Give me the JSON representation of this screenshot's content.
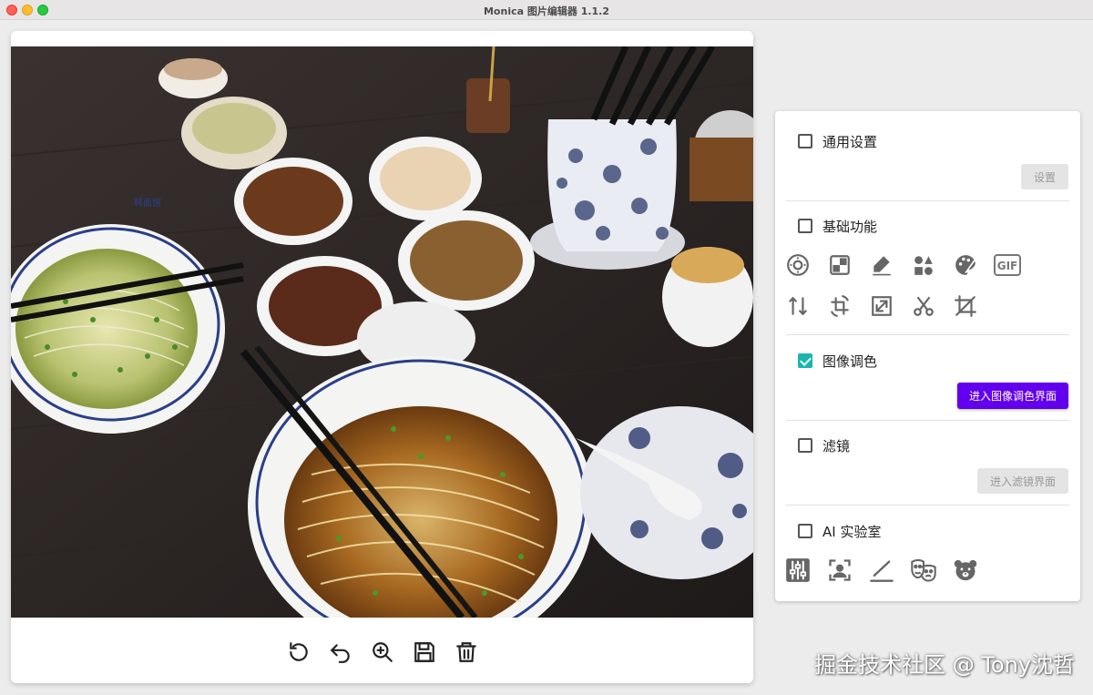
{
  "window": {
    "title": "Monica 图片编辑器 1.1.2"
  },
  "canvas": {
    "image_alt": "Two bowls of noodle soup with chopsticks, side dishes and a blue-and-white porcelain chopstick holder on a dark wooden table",
    "bowl_text": "韩面馆"
  },
  "toolbar": {
    "tools": [
      "rotate-icon",
      "undo-icon",
      "zoom-in-icon",
      "save-icon",
      "delete-icon"
    ]
  },
  "settings": {
    "general": {
      "label": "通用设置",
      "checked": false,
      "button": "设置"
    },
    "basic": {
      "label": "基础功能",
      "checked": false,
      "icons_row1": [
        "circle-blur-icon",
        "mosaic-icon",
        "draw-icon",
        "shapes-icon",
        "palette-icon",
        "gif-icon"
      ],
      "icons_row2": [
        "flip-icon",
        "rotate-crop-icon",
        "resize-icon",
        "cut-icon",
        "crop-icon"
      ],
      "gif_text": "GIF"
    },
    "color": {
      "label": "图像调色",
      "checked": true,
      "button": "进入图像调色界面"
    },
    "filter": {
      "label": "滤镜",
      "checked": false,
      "button": "进入滤镜界面"
    },
    "ai": {
      "label": "AI 实验室",
      "checked": false,
      "icons": [
        "tune-icon",
        "face-scan-icon",
        "line-draw-icon",
        "masks-icon",
        "bear-icon"
      ]
    }
  },
  "watermark": "掘金技术社区 @ Tony沈哲",
  "colors": {
    "accent": "#6200ee",
    "checkbox_checked": "#1bb5ad"
  }
}
